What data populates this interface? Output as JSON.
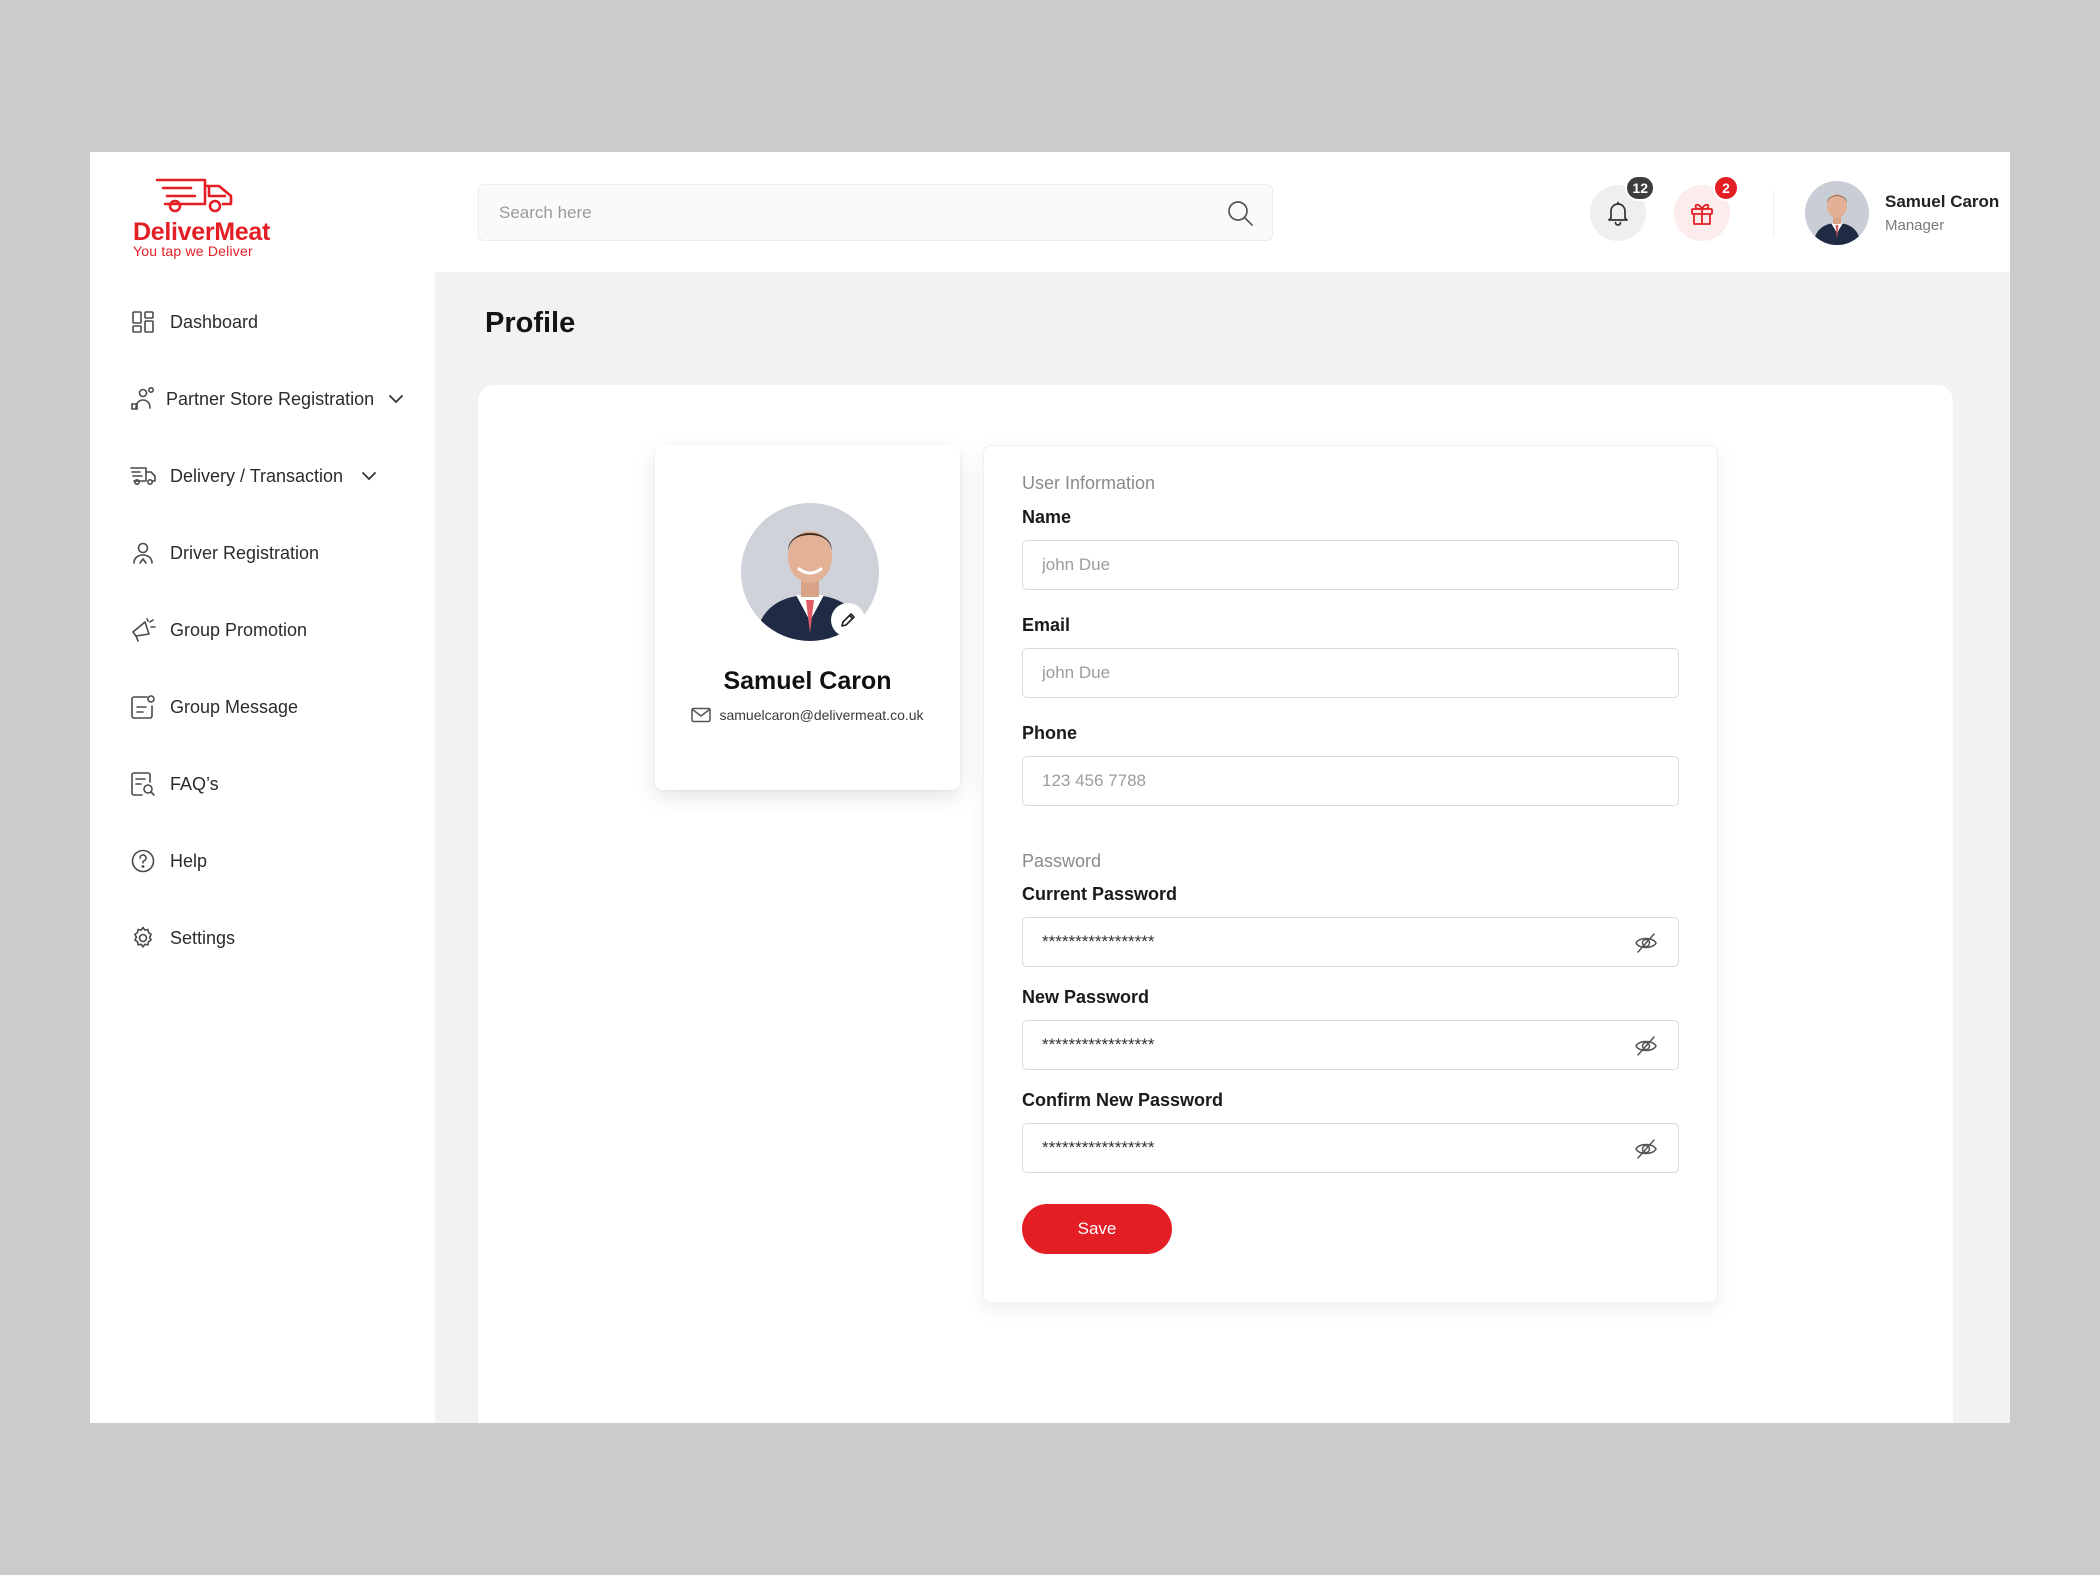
{
  "brand": {
    "name": "DeliverMeat",
    "tagline": "You tap we Deliver",
    "color": "#e31e24"
  },
  "sidebar": {
    "items": [
      {
        "label": "Dashboard",
        "icon": "dashboard-grid-icon"
      },
      {
        "label": "Partner Store Registration",
        "icon": "partner-store-icon",
        "has_submenu": true
      },
      {
        "label": "Delivery / Transaction",
        "icon": "delivery-truck-icon",
        "has_submenu": true
      },
      {
        "label": "Driver Registration",
        "icon": "driver-person-icon"
      },
      {
        "label": "Group Promotion",
        "icon": "megaphone-icon"
      },
      {
        "label": "Group Message",
        "icon": "message-icon"
      },
      {
        "label": "FAQ’s",
        "icon": "faq-document-icon"
      },
      {
        "label": "Help",
        "icon": "help-circle-icon"
      },
      {
        "label": "Settings",
        "icon": "gear-icon"
      }
    ]
  },
  "header": {
    "search_placeholder": "Search here",
    "notifications_count": "12",
    "gifts_count": "2",
    "user": {
      "name": "Samuel Caron",
      "role": "Manager"
    }
  },
  "page": {
    "title": "Profile"
  },
  "profile_card": {
    "name": "Samuel Caron",
    "email": "samuelcaron@delivermeat.co.uk"
  },
  "form": {
    "user_info_title": "User Information",
    "name_label": "Name",
    "name_placeholder": "john Due",
    "email_label": "Email",
    "email_placeholder": "john Due",
    "phone_label": "Phone",
    "phone_placeholder": "123 456 7788",
    "password_title": "Password",
    "current_password_label": "Current Password",
    "current_password_value": "*****************",
    "new_password_label": "New Password",
    "new_password_value": "*****************",
    "confirm_password_label": "Confirm New Password",
    "confirm_password_value": "*****************",
    "save_label": "Save"
  },
  "colors": {
    "accent": "#e31e24",
    "page_bg": "#f2f2f2",
    "outer_bg": "#cbcbcb"
  }
}
